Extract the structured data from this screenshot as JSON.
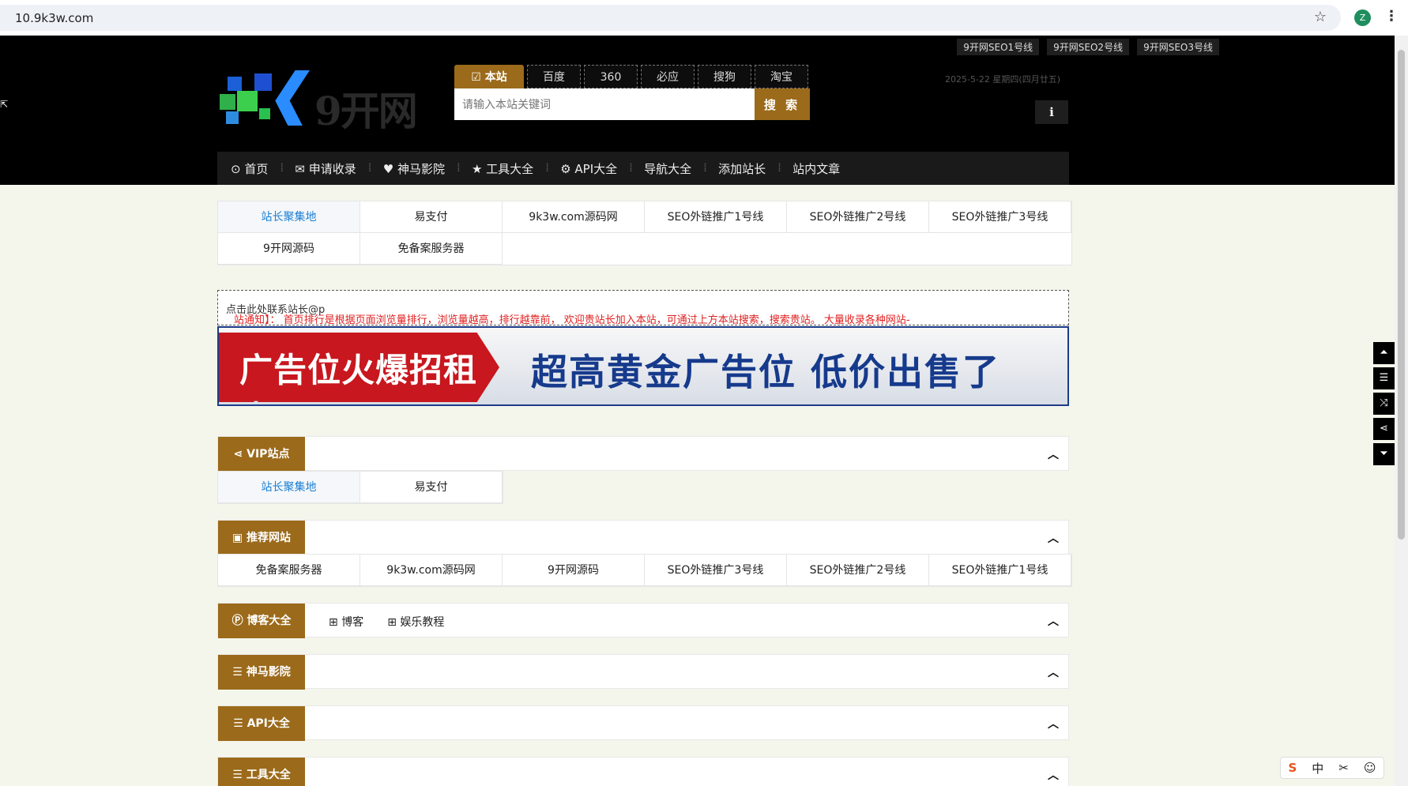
{
  "browser": {
    "url": "10.9k3w.com",
    "profile_initial": "Z"
  },
  "header": {
    "top_links": [
      "9开网SEO1号线",
      "9开网SEO2号线",
      "9开网SEO3号线"
    ],
    "logo_text": "9开网",
    "date": "2025-5-22 星期四(四月廿五)"
  },
  "search": {
    "tabs": [
      "本站",
      "百度",
      "360",
      "必应",
      "搜狗",
      "淘宝"
    ],
    "placeholder": "请输入本站关键词",
    "button": "搜 索"
  },
  "nav": {
    "items": [
      "首页",
      "申请收录",
      "神马影院",
      "工具大全",
      "API大全",
      "导航大全",
      "添加站长",
      "站内文章"
    ]
  },
  "top_grid": [
    "站长聚集地",
    "易支付",
    "9k3w.com源码网",
    "SEO外链推广1号线",
    "SEO外链推广2号线",
    "SEO外链推广3号线",
    "9开网源码",
    "免备案服务器"
  ],
  "notice": {
    "text": "站通知】：  首页排行是根据页面浏览量排行，浏览量越高，排行越靠前，  欢迎贵站长加入本站，可通过上方本站搜索，搜索贵站。  大量收录各种网站-",
    "link": "点击此处联系站长@p"
  },
  "banner": {
    "left": "广告位火爆招租中",
    "right": "超高黄金广告位 低价出售了"
  },
  "sections": [
    {
      "title": "VIP站点",
      "items": [
        "站长聚集地",
        "易支付"
      ]
    },
    {
      "title": "推荐网站",
      "items": [
        "免备案服务器",
        "9k3w.com源码网",
        "9开网源码",
        "SEO外链推广3号线",
        "SEO外链推广2号线",
        "SEO外链推广1号线"
      ]
    },
    {
      "title": "博客大全",
      "tags": [
        "博客",
        "娱乐教程"
      ]
    },
    {
      "title": "神马影院"
    },
    {
      "title": "API大全"
    },
    {
      "title": "工具大全"
    }
  ],
  "ime": [
    "S",
    "中",
    "✂",
    "☺"
  ]
}
